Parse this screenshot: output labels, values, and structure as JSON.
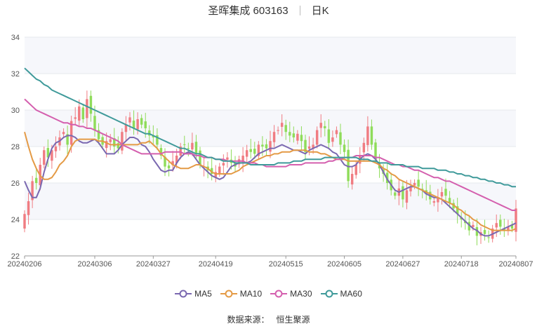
{
  "title": {
    "name": "圣晖集成 603163",
    "period": "日K"
  },
  "source": {
    "label": "数据来源：",
    "value": "恒生聚源"
  },
  "colors": {
    "up": "#f07c82",
    "down": "#8fdc5a",
    "grid_band": "#f6f7fb",
    "ma5": "#7a68b0",
    "ma10": "#e49a45",
    "ma30": "#d45fae",
    "ma60": "#3f9a9a"
  },
  "chart_data": {
    "type": "candlestick",
    "y_ticks": [
      "22",
      "24",
      "26",
      "28",
      "30",
      "32",
      "34"
    ],
    "ylim": [
      22,
      34
    ],
    "x_ticks": [
      {
        "i": 0,
        "label": "20240206"
      },
      {
        "i": 18,
        "label": "20240306"
      },
      {
        "i": 33,
        "label": "20240327"
      },
      {
        "i": 49,
        "label": "20240419"
      },
      {
        "i": 67,
        "label": "20240515"
      },
      {
        "i": 82,
        "label": "20240605"
      },
      {
        "i": 97,
        "label": "20240627"
      },
      {
        "i": 112,
        "label": "20240718"
      },
      {
        "i": 126,
        "label": "20240807"
      }
    ],
    "candle_count": 127,
    "close": [
      24.3,
      25.0,
      26.1,
      26.0,
      27.0,
      27.8,
      27.4,
      27.8,
      28.0,
      28.5,
      28.8,
      28.1,
      29.4,
      29.6,
      30.2,
      29.5,
      30.6,
      29.8,
      28.9,
      28.4,
      28.1,
      28.3,
      28.4,
      28.0,
      27.9,
      28.8,
      29.2,
      29.6,
      29.0,
      29.5,
      29.2,
      29.0,
      28.6,
      28.5,
      28.1,
      27.5,
      26.9,
      26.8,
      27.2,
      27.5,
      28.0,
      28.1,
      27.9,
      28.2,
      27.6,
      27.0,
      26.9,
      26.7,
      26.5,
      26.6,
      26.9,
      27.1,
      27.4,
      27.1,
      26.9,
      27.3,
      27.5,
      27.8,
      27.7,
      27.6,
      28.1,
      28.0,
      27.9,
      28.3,
      28.8,
      28.9,
      29.3,
      28.8,
      28.6,
      28.5,
      28.7,
      28.3,
      27.7,
      28.0,
      28.1,
      28.9,
      29.3,
      29.0,
      28.2,
      28.5,
      28.9,
      28.1,
      27.7,
      26.1,
      26.5,
      27.0,
      27.5,
      28.2,
      29.1,
      28.1,
      27.3,
      26.8,
      26.5,
      26.0,
      25.6,
      25.3,
      25.7,
      25.1,
      25.6,
      25.8,
      26.0,
      25.8,
      25.6,
      25.4,
      25.1,
      25.0,
      25.2,
      25.5,
      25.3,
      24.9,
      24.6,
      24.3,
      24.0,
      23.8,
      23.4,
      23.7,
      23.1,
      23.3,
      23.2,
      23.0,
      23.5,
      23.8,
      23.6,
      23.4,
      23.6,
      23.5,
      24.6
    ],
    "series": [
      {
        "name": "MA5",
        "values": [
          26.1,
          25.6,
          25.2,
          25.2,
          25.7,
          26.6,
          27.3,
          27.9,
          28.2,
          28.3,
          28.5,
          28.6,
          28.6,
          28.5,
          28.3,
          28.2,
          28.2,
          28.3,
          28.4,
          28.2,
          27.9,
          27.6,
          27.6,
          27.6,
          27.8,
          28.1,
          28.3,
          28.5,
          28.5,
          28.4,
          28.1,
          28.0,
          27.7,
          27.3,
          27.0,
          26.7,
          26.6,
          26.7,
          26.7,
          27.1,
          27.4,
          27.6,
          27.7,
          27.6,
          27.3,
          27.0,
          26.8,
          26.6,
          26.4,
          26.3,
          26.2,
          26.3,
          26.6,
          26.9,
          27.0,
          27.1,
          27.1,
          27.1,
          27.2,
          27.4,
          27.6,
          27.7,
          27.8,
          27.9,
          27.9,
          28.0,
          28.1,
          28.0,
          27.9,
          27.8,
          27.8,
          27.7,
          27.6,
          27.8,
          27.9,
          28.0,
          28.1,
          28.0,
          27.9,
          27.7,
          27.6,
          27.3,
          27.0,
          26.9,
          26.9,
          27.0,
          27.3,
          27.5,
          27.6,
          27.5,
          27.3,
          27.0,
          26.6,
          26.2,
          25.9,
          25.6,
          25.5,
          25.6,
          25.7,
          25.8,
          25.8,
          25.7,
          25.6,
          25.4,
          25.3,
          25.2,
          25.2,
          25.1,
          24.9,
          24.7,
          24.5,
          24.3,
          24.1,
          23.9,
          23.7,
          23.5,
          23.4,
          23.2,
          23.1,
          23.1,
          23.2,
          23.3,
          23.4,
          23.5,
          23.6,
          23.7,
          23.8
        ]
      },
      {
        "name": "MA10",
        "values": [
          28.8,
          28.0,
          27.3,
          26.8,
          26.4,
          26.2,
          26.2,
          26.3,
          26.6,
          27.0,
          27.2,
          27.5,
          28.0,
          28.3,
          28.4,
          28.4,
          28.4,
          28.4,
          28.4,
          28.3,
          28.3,
          28.2,
          28.1,
          28.1,
          28.1,
          28.1,
          28.1,
          28.1,
          28.1,
          28.1,
          28.2,
          28.2,
          28.3,
          28.1,
          27.9,
          27.6,
          27.4,
          27.2,
          27.0,
          26.9,
          26.8,
          26.8,
          26.8,
          26.9,
          27.0,
          27.0,
          26.9,
          26.8,
          26.6,
          26.5,
          26.5,
          26.5,
          26.5,
          26.5,
          26.6,
          26.7,
          26.9,
          27.0,
          27.1,
          27.2,
          27.3,
          27.4,
          27.5,
          27.5,
          27.6,
          27.6,
          27.7,
          27.7,
          27.7,
          27.8,
          27.8,
          27.8,
          27.8,
          27.7,
          27.7,
          27.7,
          27.6,
          27.6,
          27.5,
          27.4,
          27.3,
          27.3,
          27.3,
          27.2,
          27.2,
          27.2,
          27.2,
          27.2,
          27.2,
          27.2,
          27.1,
          27.0,
          26.8,
          26.7,
          26.5,
          26.4,
          26.2,
          26.1,
          26.0,
          25.9,
          25.8,
          25.7,
          25.6,
          25.5,
          25.4,
          25.3,
          25.2,
          25.1,
          25.0,
          24.9,
          24.8,
          24.6,
          24.5,
          24.3,
          24.2,
          24.0,
          23.9,
          23.7,
          23.6,
          23.5,
          23.4,
          23.4,
          23.4,
          23.4,
          23.4,
          23.4,
          23.5
        ]
      },
      {
        "name": "MA30",
        "values": [
          30.6,
          30.4,
          30.2,
          30.0,
          29.9,
          29.8,
          29.7,
          29.6,
          29.5,
          29.4,
          29.3,
          29.3,
          29.2,
          29.2,
          29.1,
          29.1,
          29.0,
          29.0,
          28.9,
          28.8,
          28.7,
          28.6,
          28.5,
          28.4,
          28.3,
          28.1,
          28.0,
          27.9,
          27.8,
          27.7,
          27.6,
          27.6,
          27.6,
          27.6,
          27.6,
          27.6,
          27.7,
          27.7,
          27.7,
          27.7,
          27.7,
          27.6,
          27.6,
          27.6,
          27.5,
          27.5,
          27.4,
          27.4,
          27.4,
          27.3,
          27.3,
          27.3,
          27.2,
          27.2,
          27.2,
          27.2,
          27.2,
          27.1,
          27.1,
          27.1,
          27.0,
          27.0,
          26.9,
          26.9,
          26.9,
          26.9,
          26.9,
          26.9,
          27.0,
          27.0,
          27.0,
          27.0,
          27.1,
          27.1,
          27.1,
          27.1,
          27.1,
          27.1,
          27.2,
          27.2,
          27.3,
          27.3,
          27.4,
          27.4,
          27.4,
          27.5,
          27.5,
          27.5,
          27.5,
          27.5,
          27.4,
          27.4,
          27.3,
          27.2,
          27.1,
          27.0,
          27.0,
          26.9,
          26.9,
          26.8,
          26.7,
          26.7,
          26.6,
          26.5,
          26.4,
          26.3,
          26.3,
          26.2,
          26.1,
          26.1,
          26.0,
          25.9,
          25.8,
          25.7,
          25.6,
          25.5,
          25.4,
          25.3,
          25.2,
          25.1,
          25.0,
          24.9,
          24.8,
          24.7,
          24.6,
          24.5,
          24.5
        ]
      },
      {
        "name": "MA60",
        "values": [
          32.3,
          32.1,
          31.9,
          31.7,
          31.6,
          31.4,
          31.3,
          31.1,
          31.0,
          30.9,
          30.8,
          30.7,
          30.6,
          30.5,
          30.4,
          30.3,
          30.2,
          30.1,
          30.0,
          29.9,
          29.8,
          29.7,
          29.6,
          29.5,
          29.4,
          29.3,
          29.2,
          29.1,
          29.0,
          28.9,
          28.8,
          28.7,
          28.7,
          28.6,
          28.5,
          28.4,
          28.3,
          28.2,
          28.1,
          28.0,
          27.9,
          27.9,
          27.8,
          27.7,
          27.6,
          27.6,
          27.5,
          27.4,
          27.4,
          27.3,
          27.3,
          27.2,
          27.2,
          27.2,
          27.1,
          27.1,
          27.1,
          27.1,
          27.0,
          27.0,
          27.0,
          27.0,
          27.0,
          27.0,
          27.0,
          27.1,
          27.1,
          27.1,
          27.1,
          27.2,
          27.2,
          27.2,
          27.3,
          27.3,
          27.3,
          27.3,
          27.3,
          27.4,
          27.4,
          27.4,
          27.4,
          27.4,
          27.4,
          27.4,
          27.4,
          27.4,
          27.3,
          27.3,
          27.3,
          27.2,
          27.2,
          27.1,
          27.1,
          27.1,
          27.0,
          27.0,
          27.0,
          27.0,
          26.9,
          26.9,
          26.9,
          26.9,
          26.8,
          26.8,
          26.8,
          26.8,
          26.7,
          26.7,
          26.7,
          26.6,
          26.6,
          26.5,
          26.5,
          26.4,
          26.4,
          26.3,
          26.3,
          26.2,
          26.2,
          26.1,
          26.1,
          26.0,
          26.0,
          25.9,
          25.9,
          25.8,
          25.8
        ]
      }
    ]
  }
}
